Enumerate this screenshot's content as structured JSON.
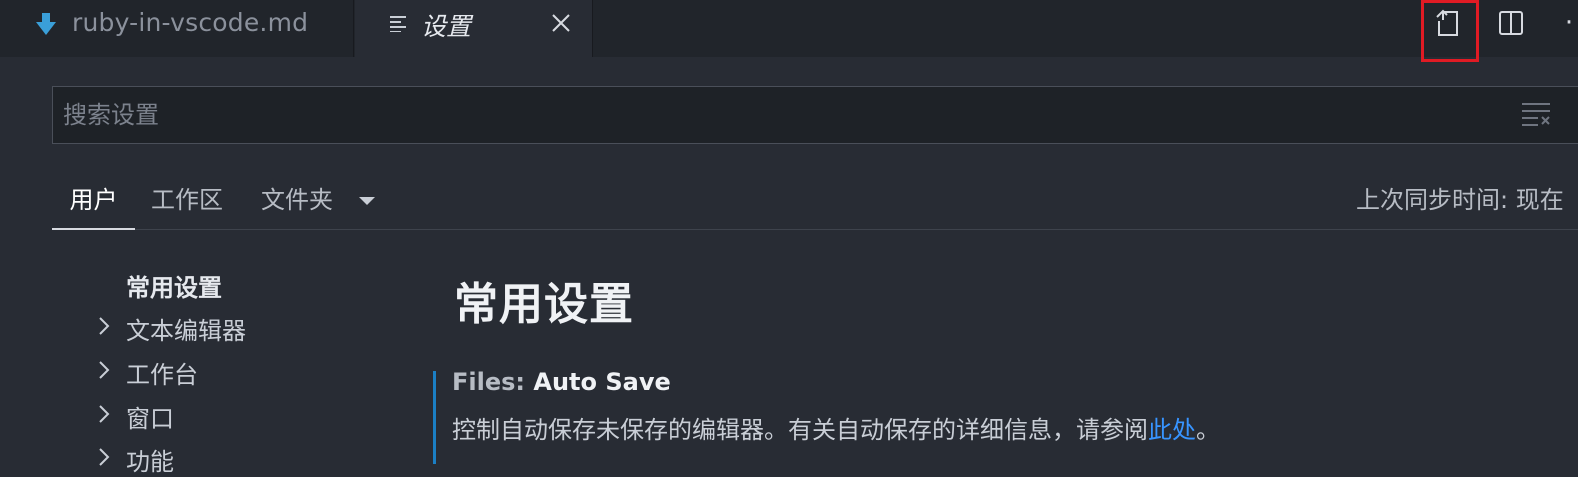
{
  "tabs": {
    "markdown_tab": {
      "label": "ruby-in-vscode.md",
      "icon": "markdown-download-icon"
    },
    "settings_tab": {
      "label": "设置",
      "icon": "settings-list-icon"
    }
  },
  "toolbar": {
    "open_json_icon": "open-settings-json-icon",
    "split_icon": "split-editor-icon",
    "more_icon": "more-actions-icon",
    "more_glyph": "·"
  },
  "search": {
    "placeholder": "搜索设置",
    "value": ""
  },
  "scope_tabs": {
    "user": "用户",
    "workspace": "工作区",
    "folder": "文件夹",
    "sync_status": "上次同步时间: 现在"
  },
  "toc": {
    "items": [
      {
        "label": "常用设置",
        "expandable": false,
        "active": true
      },
      {
        "label": "文本编辑器",
        "expandable": true
      },
      {
        "label": "工作台",
        "expandable": true
      },
      {
        "label": "窗口",
        "expandable": true
      },
      {
        "label": "功能",
        "expandable": true
      }
    ]
  },
  "content": {
    "section_title": "常用设置",
    "setting": {
      "category": "Files: ",
      "name": "Auto Save",
      "description_prefix": "控制自动保存未保存的编辑器。有关自动保存的详细信息，请参阅",
      "link": "此处",
      "description_suffix": "。"
    }
  },
  "colors": {
    "background": "#282c34",
    "tabbar": "#21252b",
    "highlight": "#e01b24",
    "link": "#3794ff",
    "setting_bar": "#1b7fc4"
  }
}
